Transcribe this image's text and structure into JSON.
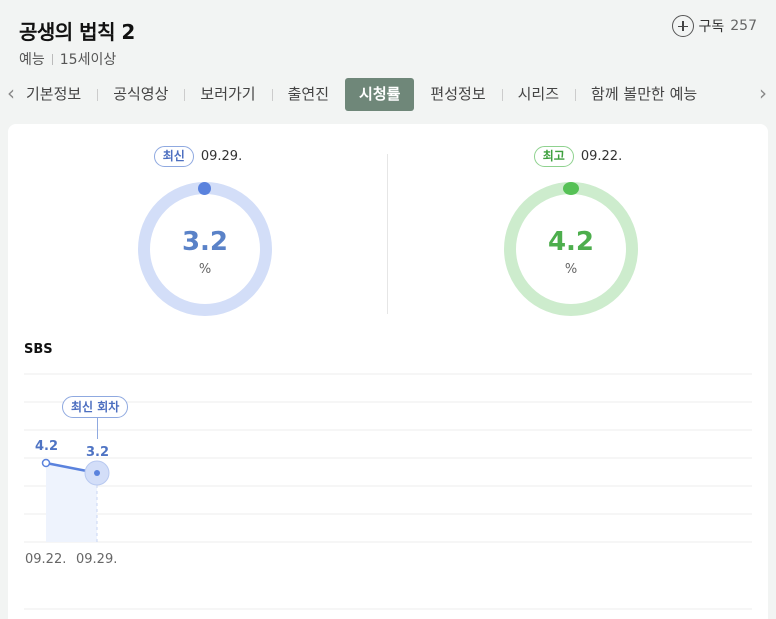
{
  "header": {
    "title": "공생의 법칙 2",
    "genre": "예능",
    "rating": "15세이상",
    "subscribe_label": "구독",
    "subscribe_count": "257"
  },
  "tabs": [
    {
      "label": "기본정보",
      "active": false
    },
    {
      "label": "공식영상",
      "active": false
    },
    {
      "label": "보러가기",
      "active": false
    },
    {
      "label": "출연진",
      "active": false
    },
    {
      "label": "시청률",
      "active": true
    },
    {
      "label": "편성정보",
      "active": false
    },
    {
      "label": "시리즈",
      "active": false
    },
    {
      "label": "함께 볼만한 예능",
      "active": false
    }
  ],
  "summary": {
    "latest": {
      "badge": "최신",
      "date": "09.29.",
      "value": "3.2",
      "unit": "%",
      "color": "#5a82dd"
    },
    "best": {
      "badge": "최고",
      "date": "09.22.",
      "value": "4.2",
      "unit": "%",
      "color": "#56c156"
    }
  },
  "chart_data": {
    "type": "line",
    "channel": "SBS",
    "callout": "최신 회차",
    "x": [
      "09.22.",
      "09.29."
    ],
    "values": [
      4.2,
      3.2
    ],
    "value_labels": [
      "4.2",
      "3.2"
    ],
    "grid": true
  },
  "colors": {
    "accent_tab": "#6f8779",
    "line": "#5a82dd",
    "best": "#56c156"
  }
}
